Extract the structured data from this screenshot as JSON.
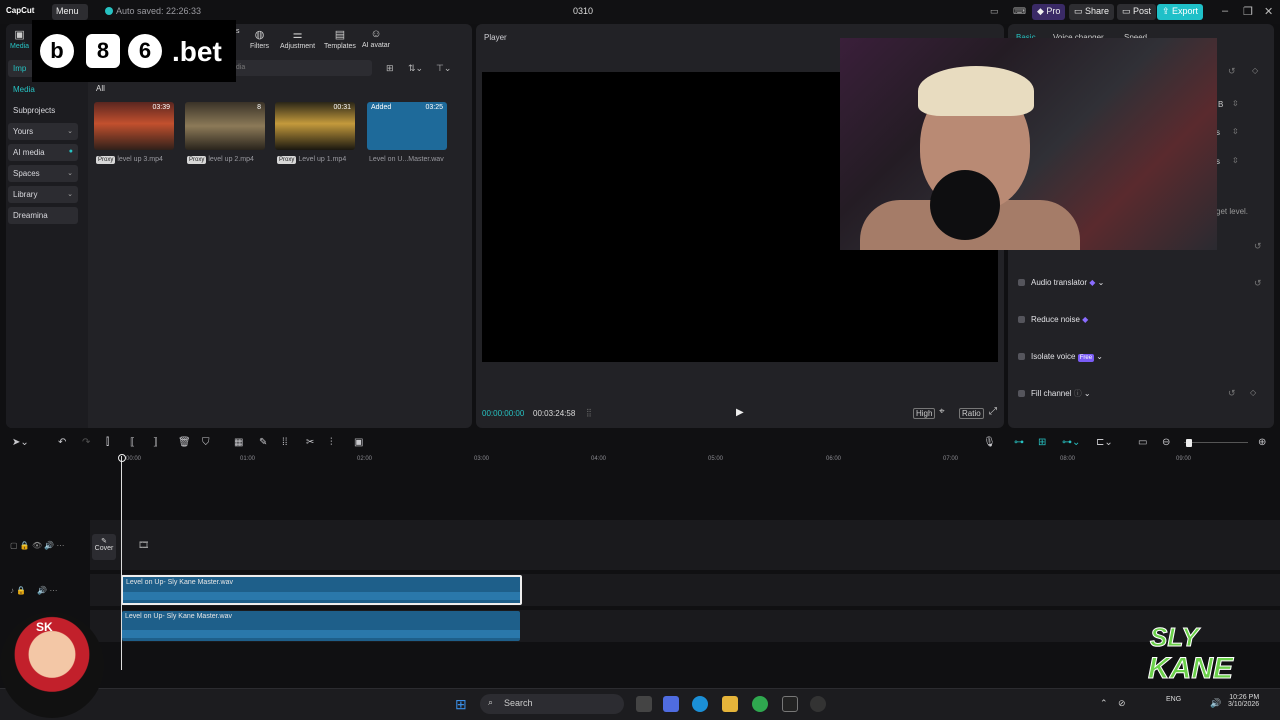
{
  "app": {
    "logo_text": "CapCut",
    "menu_label": "Menu",
    "autosave_text": "Auto saved: 22:26:33",
    "project_title": "0310",
    "pro_label": "Pro",
    "share_label": "Share",
    "post_label": "Post",
    "export_label": "Export"
  },
  "media_panel": {
    "top_tabs": [
      {
        "label": "Media",
        "icon": "media-icon"
      },
      {
        "label": "Filters",
        "icon": "filters-icon"
      },
      {
        "label": "Adjustment",
        "icon": "adjustment-icon"
      },
      {
        "label": "Templates",
        "icon": "templates-icon"
      },
      {
        "label": "AI avatar",
        "icon": "ai-avatar-icon"
      }
    ],
    "partial_tab_suffix": "s",
    "side_nav": [
      {
        "label": "Imp"
      },
      {
        "label": "Media"
      },
      {
        "label": "Subprojects"
      },
      {
        "label": "Yours"
      },
      {
        "label": "AI media"
      },
      {
        "label": "Spaces"
      },
      {
        "label": "Library"
      },
      {
        "label": "Dreamina"
      }
    ],
    "search_placeholder": "edia",
    "filter_label": "All",
    "assets": [
      {
        "duration": "03:39",
        "name": "level up 3.mp4",
        "badge": "Proxy"
      },
      {
        "duration": "8",
        "name": "level up 2.mp4",
        "badge": "Proxy"
      },
      {
        "duration": "00:31",
        "name": "Level up 1.mp4",
        "badge": "Proxy"
      },
      {
        "duration": "03:25",
        "name": "Level on U...Master.wav",
        "badge": "Added"
      }
    ]
  },
  "player": {
    "title": "Player",
    "current_time": "00:00:00:00",
    "total_time": "00:03:24:58",
    "controls": [
      "High",
      "Ratio"
    ]
  },
  "props_panel": {
    "tabs": [
      "Basic",
      "Voice changer",
      "Speed"
    ],
    "value_fragments": [
      "B",
      "s",
      "s"
    ],
    "hint_text": "get level.",
    "rows": [
      {
        "label": "Audio translator"
      },
      {
        "label": "Reduce noise"
      },
      {
        "label": "Isolate voice",
        "badge": "Free"
      },
      {
        "label": "Fill channel"
      }
    ]
  },
  "timeline": {
    "ruler_ticks": [
      "00:00",
      "01:00",
      "02:00",
      "03:00",
      "04:00",
      "05:00",
      "06:00",
      "07:00",
      "08:00",
      "09:00"
    ],
    "cover_label": "Cover",
    "clips": [
      {
        "label": "Level on Up- Sly Kane Master.wav"
      },
      {
        "label": "Level on Up- Sly Kane Master.wav"
      }
    ]
  },
  "taskbar": {
    "search_label": "Search",
    "time": "10:26 PM",
    "date": "3/10/2026",
    "lang": "ENG"
  },
  "overlays": {
    "brand_word": ".bet",
    "brand_coins": [
      "b",
      "8",
      "6"
    ],
    "avatar_initials": "SK",
    "logo_lines": [
      "SLY",
      "KANE"
    ]
  }
}
